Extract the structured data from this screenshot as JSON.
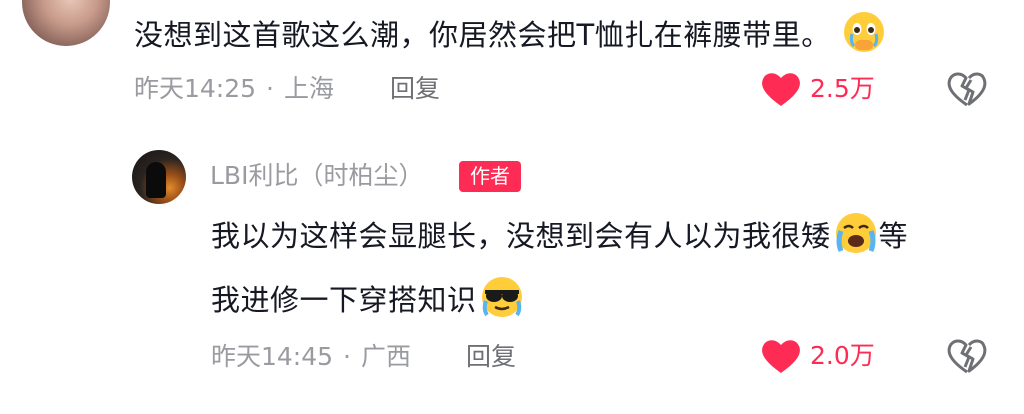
{
  "comment1": {
    "text": "没想到这首歌这么潮，你居然会把T恤扎在裤腰带里。",
    "time": "昨天14:25",
    "separator": "·",
    "location": "上海",
    "reply_label": "回复",
    "likes": "2.5万",
    "emoji_icon": "pleading-crying-face-icon"
  },
  "comment2": {
    "username": "LBI利比（时柏尘）",
    "badge": "作者",
    "text_line1": "我以为这样会显腿长，没想到会有人以为我很矮",
    "text_line1_tail": "等",
    "text_line2": "我进修一下穿搭知识",
    "time": "昨天14:45",
    "separator": "·",
    "location": "广西",
    "reply_label": "回复",
    "likes": "2.0万",
    "emoji1_icon": "loudly-crying-face-icon",
    "emoji2_icon": "crying-sunglasses-face-icon"
  },
  "colors": {
    "accent": "#fe2c55",
    "text": "#161823",
    "meta": "#9a9ba0"
  }
}
